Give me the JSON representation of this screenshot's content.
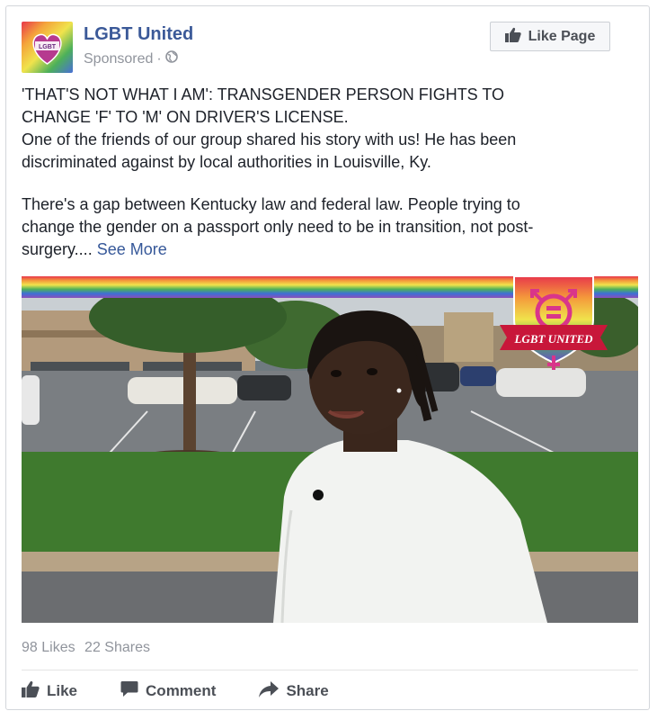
{
  "post": {
    "page_name": "LGBT United",
    "sponsored": "Sponsored",
    "separator": "·",
    "like_page_label": "Like Page",
    "headline_line1": "'THAT'S NOT WHAT I AM': TRANSGENDER PERSON FIGHTS TO",
    "headline_line2": "CHANGE 'F' TO 'M' ON DRIVER'S LICENSE.",
    "body_line1": "One of the friends of our group shared his story with us! He has been",
    "body_line2": "discriminated against by local authorities in Louisville, Ky.",
    "body2_line1": "There's a gap between Kentucky law and federal law. People trying to",
    "body2_line2": "change the gender on a passport only need to be in transition, not post-",
    "body2_line3": "surgery....",
    "see_more": "See More"
  },
  "media": {
    "logo_text": "LGBT UNITED",
    "avatar_text": "LGBT"
  },
  "stats": {
    "likes": "98 Likes",
    "shares": "22 Shares"
  },
  "actions": {
    "like": "Like",
    "comment": "Comment",
    "share": "Share"
  },
  "icons": [
    "globe-icon",
    "thumbs-up-icon",
    "comment-icon",
    "share-arrow-icon"
  ],
  "colors": {
    "link": "#3b5998",
    "muted": "#90949c",
    "button_bg": "#f6f7f9",
    "action_text": "#4b4f56"
  }
}
